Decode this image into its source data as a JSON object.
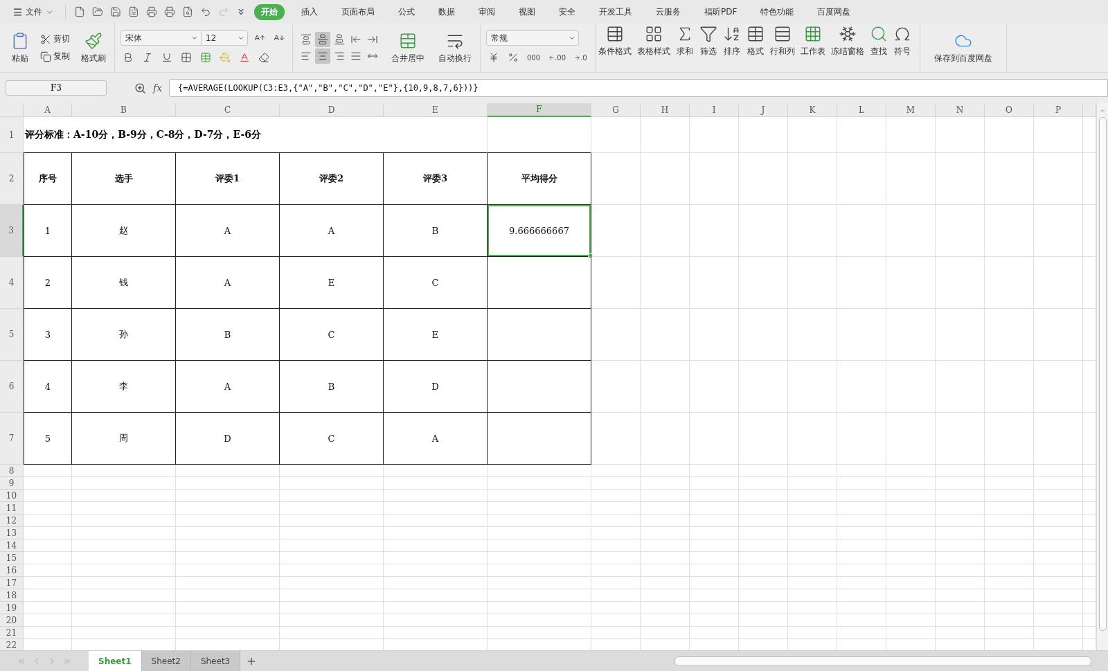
{
  "menu": {
    "file_label": "文件",
    "tabs": [
      {
        "label": "开始",
        "selected": true
      },
      {
        "label": "插入",
        "selected": false
      },
      {
        "label": "页面布局",
        "selected": false
      },
      {
        "label": "公式",
        "selected": false
      },
      {
        "label": "数据",
        "selected": false
      },
      {
        "label": "审阅",
        "selected": false
      },
      {
        "label": "视图",
        "selected": false
      },
      {
        "label": "安全",
        "selected": false
      },
      {
        "label": "开发工具",
        "selected": false
      },
      {
        "label": "云服务",
        "selected": false
      },
      {
        "label": "福昕PDF",
        "selected": false
      },
      {
        "label": "特色功能",
        "selected": false
      },
      {
        "label": "百度网盘",
        "selected": false
      }
    ]
  },
  "ribbon": {
    "paste": "粘贴",
    "cut": "剪切",
    "copy": "复制",
    "painter": "格式刷",
    "font_name": "宋体",
    "font_size": "12",
    "align_buttons": [
      {
        "kind": "top",
        "selected": false
      },
      {
        "kind": "middle",
        "selected": true
      },
      {
        "kind": "bottom",
        "selected": false
      },
      {
        "kind": "outdent",
        "selected": false
      },
      {
        "kind": "indent",
        "selected": false
      },
      {
        "kind": "left",
        "selected": false
      },
      {
        "kind": "center",
        "selected": true
      },
      {
        "kind": "right",
        "selected": false
      },
      {
        "kind": "justify",
        "selected": false
      },
      {
        "kind": "distributed",
        "selected": false
      }
    ],
    "merge": "合并居中",
    "wrap": "自动换行",
    "number_format": "常规",
    "number_buttons": [
      {
        "kind": "currency"
      },
      {
        "kind": "percent"
      },
      {
        "kind": "thousands",
        "label": "000"
      },
      {
        "kind": "more_decimals",
        "label": ".00"
      },
      {
        "kind": "fewer_decimals",
        "label": ".0"
      }
    ],
    "tools": [
      {
        "kind": "conditional",
        "label": "条件格式"
      },
      {
        "kind": "table_style",
        "label": "表格样式"
      },
      {
        "kind": "sum",
        "label": "求和"
      },
      {
        "kind": "filter",
        "label": "筛选"
      },
      {
        "kind": "sort",
        "label": "排序"
      },
      {
        "kind": "format",
        "label": "格式"
      },
      {
        "kind": "rows_cols",
        "label": "行和列"
      },
      {
        "kind": "worksheet",
        "label": "工作表"
      },
      {
        "kind": "freeze",
        "label": "冻结窗格"
      },
      {
        "kind": "find",
        "label": "查找"
      },
      {
        "kind": "symbol",
        "label": "符号"
      }
    ],
    "save_cloud": "保存到百度网盘"
  },
  "formula_bar": {
    "name_box": "F3",
    "fx": "fx",
    "formula": "{=AVERAGE(LOOKUP(C3:E3,{\"A\",\"B\",\"C\",\"D\",\"E\"},{10,9,8,7,6}))}"
  },
  "sheet": {
    "columns": [
      {
        "label": "A",
        "selected": false
      },
      {
        "label": "B",
        "selected": false
      },
      {
        "label": "C",
        "selected": false
      },
      {
        "label": "D",
        "selected": false
      },
      {
        "label": "E",
        "selected": false
      },
      {
        "label": "F",
        "selected": true
      },
      {
        "label": "G",
        "selected": false
      },
      {
        "label": "H",
        "selected": false
      },
      {
        "label": "I",
        "selected": false
      },
      {
        "label": "J",
        "selected": false
      },
      {
        "label": "K",
        "selected": false
      },
      {
        "label": "L",
        "selected": false
      },
      {
        "label": "M",
        "selected": false
      },
      {
        "label": "N",
        "selected": false
      },
      {
        "label": "O",
        "selected": false
      },
      {
        "label": "P",
        "selected": false
      }
    ],
    "note_row": {
      "label": "1",
      "selected": false,
      "text": "评分标准：A-10分，B-9分，C-8分，D-7分，E-6分"
    },
    "table_rows": [
      {
        "label": "2",
        "selected": false,
        "header": true,
        "cells": [
          "序号",
          "选手",
          "评委1",
          "评委2",
          "评委3",
          "平均得分"
        ]
      },
      {
        "label": "3",
        "selected": true,
        "header": false,
        "cells": [
          "1",
          "赵",
          "A",
          "A",
          "B",
          "9.666666667"
        ]
      },
      {
        "label": "4",
        "selected": false,
        "header": false,
        "cells": [
          "2",
          "钱",
          "A",
          "E",
          "C"
        ]
      },
      {
        "label": "5",
        "selected": false,
        "header": false,
        "cells": [
          "3",
          "孙",
          "B",
          "C",
          "E"
        ]
      },
      {
        "label": "6",
        "selected": false,
        "header": false,
        "cells": [
          "4",
          "李",
          "A",
          "B",
          "D"
        ]
      },
      {
        "label": "7",
        "selected": false,
        "header": false,
        "cells": [
          "5",
          "周",
          "D",
          "C",
          "A"
        ]
      }
    ],
    "empty_rows": [
      {
        "label": "8",
        "selected": false
      },
      {
        "label": "9",
        "selected": false
      },
      {
        "label": "10",
        "selected": false
      },
      {
        "label": "11",
        "selected": false
      },
      {
        "label": "12",
        "selected": false
      },
      {
        "label": "13",
        "selected": false
      },
      {
        "label": "14",
        "selected": false
      },
      {
        "label": "15",
        "selected": false
      },
      {
        "label": "16",
        "selected": false
      },
      {
        "label": "17",
        "selected": false
      },
      {
        "label": "18",
        "selected": false
      },
      {
        "label": "19",
        "selected": false
      },
      {
        "label": "20",
        "selected": false
      },
      {
        "label": "21",
        "selected": false
      },
      {
        "label": "22",
        "selected": false
      }
    ]
  },
  "sheet_tabs": [
    {
      "label": "Sheet1",
      "selected": true
    },
    {
      "label": "Sheet2",
      "selected": false
    },
    {
      "label": "Sheet3",
      "selected": false
    }
  ]
}
